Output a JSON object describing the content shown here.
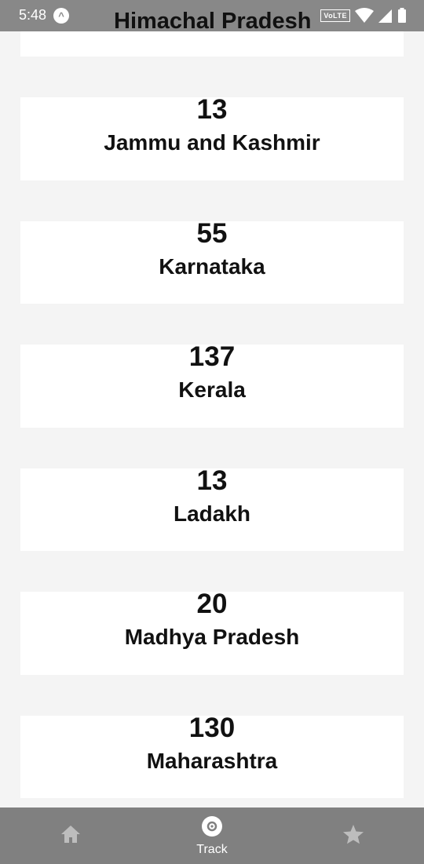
{
  "status_bar": {
    "time": "5:48",
    "app_icon_glyph": "^",
    "network_badge": "VoLTE",
    "icons": [
      "wifi-icon",
      "cellular-signal-icon",
      "battery-icon"
    ]
  },
  "header": {
    "partial_title": "Himachal Pradesh"
  },
  "states": [
    {
      "count": "13",
      "name": "Jammu and Kashmir"
    },
    {
      "count": "55",
      "name": "Karnataka"
    },
    {
      "count": "137",
      "name": "Kerala"
    },
    {
      "count": "13",
      "name": "Ladakh"
    },
    {
      "count": "20",
      "name": "Madhya Pradesh"
    },
    {
      "count": "130",
      "name": "Maharashtra"
    }
  ],
  "bottom_nav": {
    "items": [
      {
        "icon": "home-icon",
        "label": ""
      },
      {
        "icon": "track-icon",
        "label": "Track"
      },
      {
        "icon": "star-icon",
        "label": ""
      }
    ]
  },
  "colors": {
    "background": "#f4f4f4",
    "card": "#ffffff",
    "status_bar": "#888888",
    "bottom_nav": "#808080",
    "text": "#111111"
  }
}
